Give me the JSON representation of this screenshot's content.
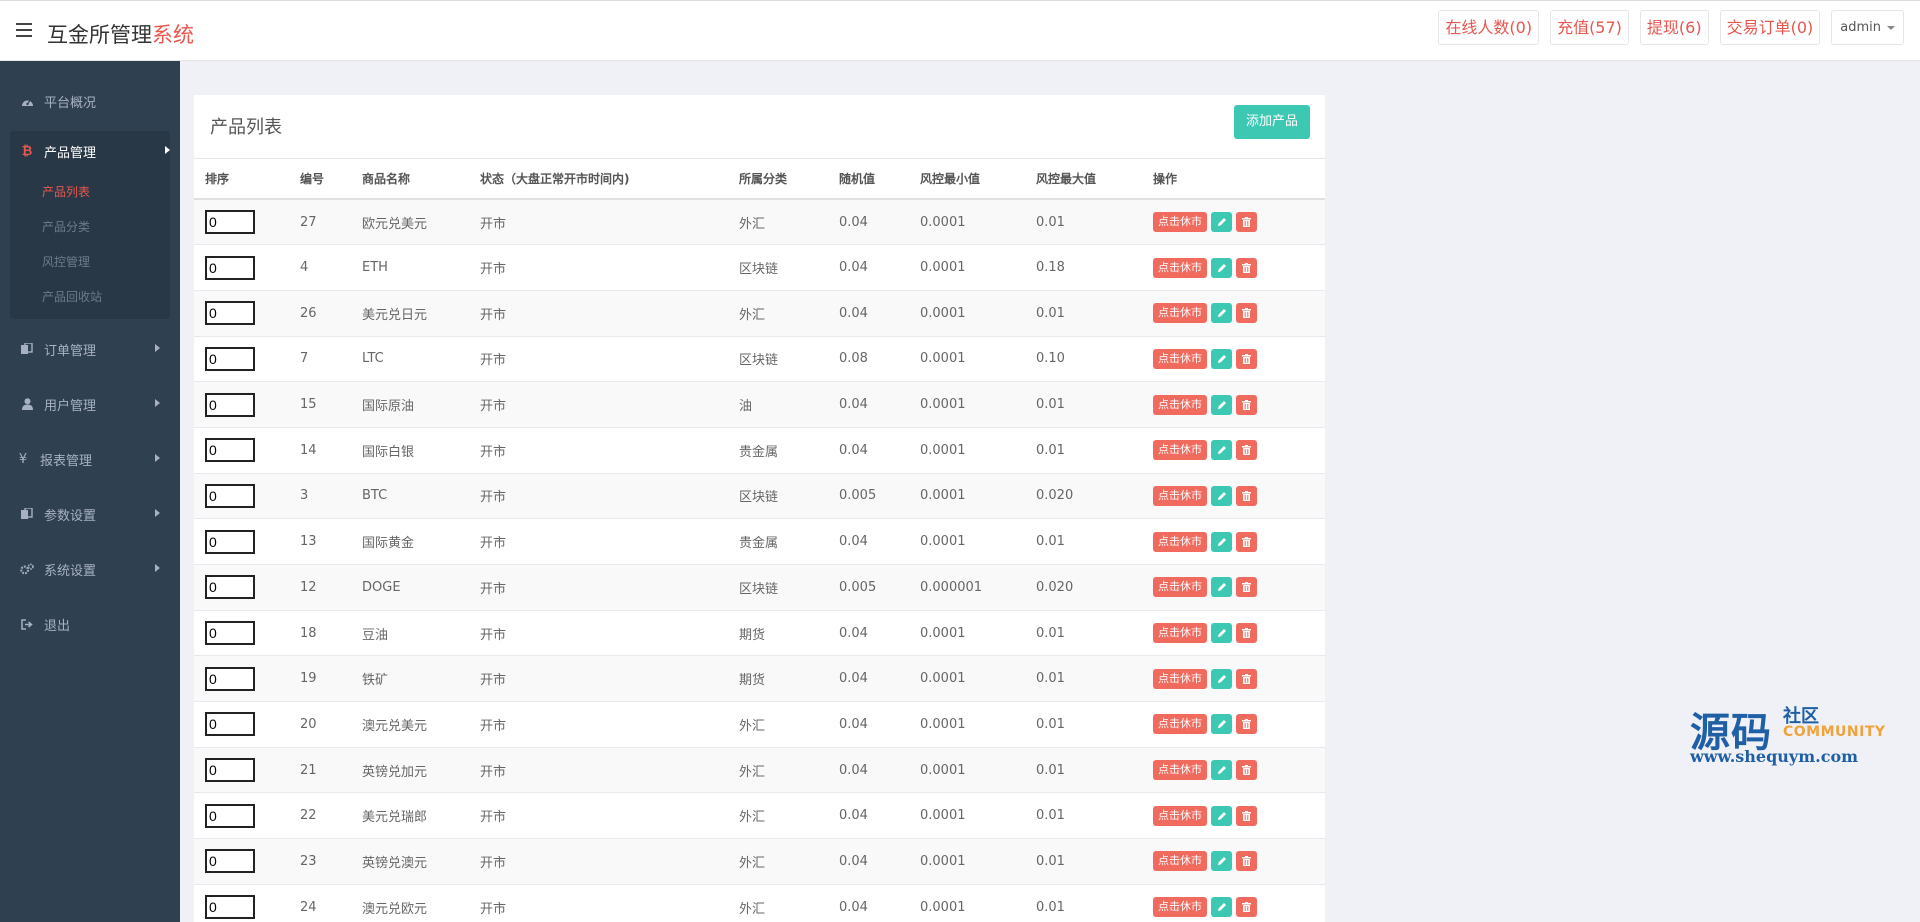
{
  "header": {
    "brand_main": "互金所管理",
    "brand_accent": "系统",
    "actions": [
      "在线人数(0)",
      "充值(57)",
      "提现(6)",
      "交易订单(0)"
    ],
    "user": "admin"
  },
  "sidebar": {
    "items": [
      {
        "label": "平台概况",
        "icon": "dashboard-icon"
      },
      {
        "label": "产品管理",
        "icon": "bitcoin-icon"
      },
      {
        "label": "订单管理",
        "icon": "files-icon"
      },
      {
        "label": "用户管理",
        "icon": "user-icon"
      },
      {
        "label": "报表管理",
        "icon": "yen-icon"
      },
      {
        "label": "参数设置",
        "icon": "files-icon"
      },
      {
        "label": "系统设置",
        "icon": "gears-icon"
      },
      {
        "label": "退出",
        "icon": "sign-out-icon"
      }
    ],
    "subitems": [
      "产品列表",
      "产品分类",
      "风控管理",
      "产品回收站"
    ]
  },
  "panel": {
    "title": "产品列表",
    "add_button": "添加产品"
  },
  "table": {
    "headers": [
      "排序",
      "编号",
      "商品名称",
      "状态（大盘正常开市时间内)",
      "所属分类",
      "随机值",
      "风控最小值",
      "风控最大值",
      "操作"
    ],
    "close_label": "点击休市",
    "rows": [
      {
        "sort": "0",
        "id": "27",
        "name": "欧元兑美元",
        "status": "开市",
        "category": "外汇",
        "random": "0.04",
        "min": "0.0001",
        "max": "0.01"
      },
      {
        "sort": "0",
        "id": "4",
        "name": "ETH",
        "status": "开市",
        "category": "区块链",
        "random": "0.04",
        "min": "0.0001",
        "max": "0.18"
      },
      {
        "sort": "0",
        "id": "26",
        "name": "美元兑日元",
        "status": "开市",
        "category": "外汇",
        "random": "0.04",
        "min": "0.0001",
        "max": "0.01"
      },
      {
        "sort": "0",
        "id": "7",
        "name": "LTC",
        "status": "开市",
        "category": "区块链",
        "random": "0.08",
        "min": "0.0001",
        "max": "0.10"
      },
      {
        "sort": "0",
        "id": "15",
        "name": "国际原油",
        "status": "开市",
        "category": "油",
        "random": "0.04",
        "min": "0.0001",
        "max": "0.01"
      },
      {
        "sort": "0",
        "id": "14",
        "name": "国际白银",
        "status": "开市",
        "category": "贵金属",
        "random": "0.04",
        "min": "0.0001",
        "max": "0.01"
      },
      {
        "sort": "0",
        "id": "3",
        "name": "BTC",
        "status": "开市",
        "category": "区块链",
        "random": "0.005",
        "min": "0.0001",
        "max": "0.020"
      },
      {
        "sort": "0",
        "id": "13",
        "name": "国际黄金",
        "status": "开市",
        "category": "贵金属",
        "random": "0.04",
        "min": "0.0001",
        "max": "0.01"
      },
      {
        "sort": "0",
        "id": "12",
        "name": "DOGE",
        "status": "开市",
        "category": "区块链",
        "random": "0.005",
        "min": "0.000001",
        "max": "0.020"
      },
      {
        "sort": "0",
        "id": "18",
        "name": "豆油",
        "status": "开市",
        "category": "期货",
        "random": "0.04",
        "min": "0.0001",
        "max": "0.01"
      },
      {
        "sort": "0",
        "id": "19",
        "name": "铁矿",
        "status": "开市",
        "category": "期货",
        "random": "0.04",
        "min": "0.0001",
        "max": "0.01"
      },
      {
        "sort": "0",
        "id": "20",
        "name": "澳元兑美元",
        "status": "开市",
        "category": "外汇",
        "random": "0.04",
        "min": "0.0001",
        "max": "0.01"
      },
      {
        "sort": "0",
        "id": "21",
        "name": "英镑兑加元",
        "status": "开市",
        "category": "外汇",
        "random": "0.04",
        "min": "0.0001",
        "max": "0.01"
      },
      {
        "sort": "0",
        "id": "22",
        "name": "美元兑瑞郎",
        "status": "开市",
        "category": "外汇",
        "random": "0.04",
        "min": "0.0001",
        "max": "0.01"
      },
      {
        "sort": "0",
        "id": "23",
        "name": "英镑兑澳元",
        "status": "开市",
        "category": "外汇",
        "random": "0.04",
        "min": "0.0001",
        "max": "0.01"
      },
      {
        "sort": "0",
        "id": "24",
        "name": "澳元兑欧元",
        "status": "开市",
        "category": "外汇",
        "random": "0.04",
        "min": "0.0001",
        "max": "0.01"
      }
    ]
  },
  "watermark": {
    "big": "源码",
    "small": "社区",
    "community": "COMMUNITY",
    "url": "www.shequym.com"
  }
}
